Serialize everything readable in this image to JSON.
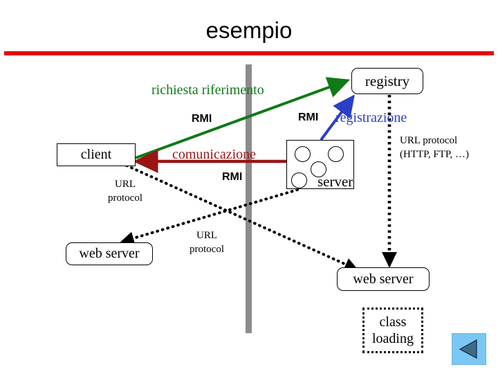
{
  "slide": {
    "title": "esempio",
    "accent_rule_color": "#e60000",
    "divider_color": "#8c8c8c",
    "background": "#ffffff"
  },
  "nodes": {
    "client": {
      "label": "client",
      "shape": "rectangle"
    },
    "registry": {
      "label": "registry",
      "shape": "rounded-rectangle"
    },
    "server": {
      "label": "server",
      "shape": "rectangle",
      "circle_count": 4
    },
    "web_server_left": {
      "label": "web server",
      "shape": "rounded-rectangle"
    },
    "web_server_right": {
      "label": "web server",
      "shape": "rounded-rectangle"
    },
    "class_loading": {
      "line1": "class",
      "line2": "loading",
      "shape": "dotted-rectangle"
    }
  },
  "labels": {
    "richiesta_riferimento": {
      "text": "richiesta riferimento",
      "color": "#0f7a16"
    },
    "rmi_1": "RMI",
    "rmi_2": "RMI",
    "rmi_3": "RMI",
    "registrazione": {
      "text": "registrazione",
      "color": "#2b3fc4"
    },
    "comunicazione": {
      "text": "comunicazione",
      "color": "#9b1414"
    },
    "url_protocol_left": "URL protocol",
    "url_protocol_mid": "URL protocol",
    "url_protocol_right": "URL protocol (HTTP, FTP, …)"
  },
  "connectors": [
    {
      "name": "richiesta-riferimento-arrow",
      "from": "client",
      "to": "registry",
      "style": "solid",
      "color": "#0f7a16",
      "arrowheads": 1
    },
    {
      "name": "registrazione-arrow",
      "from": "server",
      "to": "registry",
      "style": "solid",
      "color": "#2b3fc4",
      "arrowheads": 1
    },
    {
      "name": "comunicazione-arrow",
      "from": "client",
      "to": "server",
      "style": "solid",
      "color": "#9b1414",
      "arrowheads": 2
    },
    {
      "name": "client-to-web-server-right",
      "from": "client",
      "to": "web_server_right",
      "style": "dotted",
      "color": "#000000",
      "arrowheads": 1
    },
    {
      "name": "server-to-web-server-left",
      "from": "server",
      "to": "web_server_left",
      "style": "dotted",
      "color": "#000000",
      "arrowheads": 1
    },
    {
      "name": "registry-to-web-server-right",
      "from": "registry",
      "to": "web_server_right",
      "style": "dotted",
      "color": "#000000",
      "arrowheads": 1
    }
  ],
  "nav": {
    "back_button": {
      "icon": "triangle-left-icon",
      "face_color": "#7ac7f5",
      "glyph_color": "#2f5f7d"
    }
  }
}
